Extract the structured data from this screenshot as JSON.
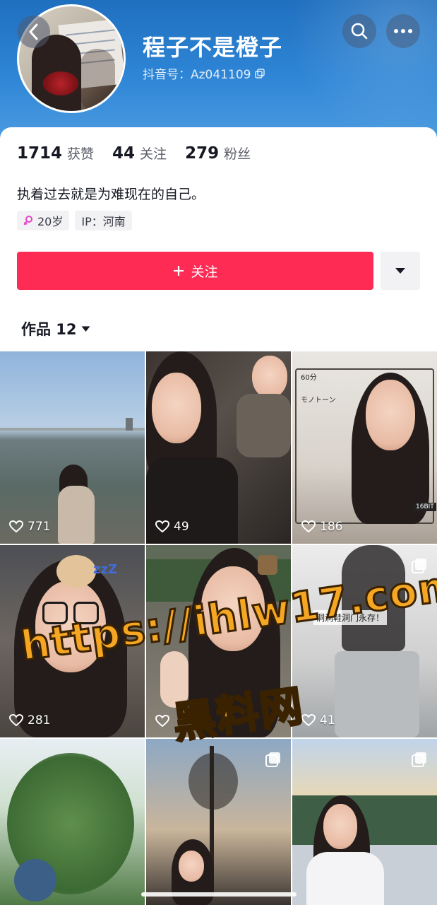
{
  "profile": {
    "nickname": "程子不是橙子",
    "douyin_id": "抖音号：Az041109"
  },
  "stats": [
    {
      "num": "1714",
      "label": "获赞"
    },
    {
      "num": "44",
      "label": "关注"
    },
    {
      "num": "279",
      "label": "粉丝"
    }
  ],
  "bio": "执着过去就是为难现在的自己。",
  "tags": {
    "age": "20岁",
    "ip": "IP：河南"
  },
  "follow_button": "关注",
  "works_tab": "作品 12",
  "videos": [
    {
      "likes": "771"
    },
    {
      "likes": "49"
    },
    {
      "likes": "186",
      "overlay_top": "60分",
      "overlay_sub": "モノトーン",
      "overlay_corner": "16BIT"
    },
    {
      "likes": "281",
      "sticker": "zzZ"
    },
    {
      "likes": ""
    },
    {
      "likes": "41",
      "caption": "洞洞鞋洞门永存！"
    },
    {
      "likes": ""
    },
    {
      "likes": ""
    },
    {
      "likes": ""
    }
  ],
  "watermark": {
    "url": "https://ihlw17.com",
    "cn": "黑料网"
  },
  "colors": {
    "accent": "#fe2c55",
    "banner": "#2f86d6",
    "watermark": "#f5a623"
  },
  "icons": [
    "back-arrow-icon",
    "search-icon",
    "more-dots-icon",
    "copy-icon",
    "female-icon",
    "plus-icon",
    "caret-down-icon",
    "heart-icon",
    "multi-image-icon"
  ]
}
